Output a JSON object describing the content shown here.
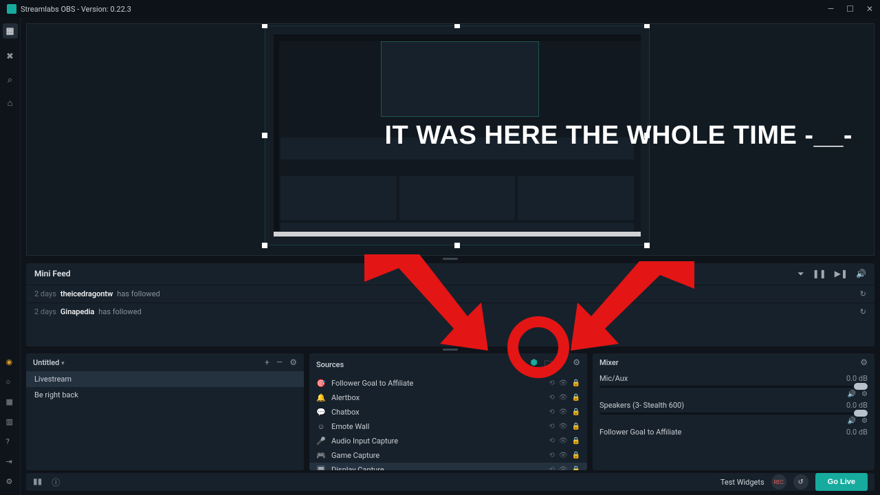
{
  "titlebar": {
    "title": "Streamlabs OBS - Version: 0.22.3"
  },
  "overlay": {
    "text": "IT WAS HERE THE WHOLE TIME -__-"
  },
  "minifeed": {
    "title": "Mini Feed",
    "items": [
      {
        "time": "2 days",
        "name": "theicedragontw",
        "action": "has followed"
      },
      {
        "time": "2 days",
        "name": "Ginapedia",
        "action": "has followed"
      }
    ]
  },
  "scenes": {
    "title": "Untitled",
    "items": [
      {
        "label": "Livestream",
        "selected": true
      },
      {
        "label": "Be right back",
        "selected": false
      }
    ]
  },
  "sources": {
    "title": "Sources",
    "items": [
      {
        "icon": "goal-icon",
        "glyph": "🎯",
        "label": "Follower Goal to Affiliate",
        "selected": false
      },
      {
        "icon": "bell-icon",
        "glyph": "🔔",
        "label": "Alertbox",
        "selected": false
      },
      {
        "icon": "chat-icon",
        "glyph": "💬",
        "label": "Chatbox",
        "selected": false
      },
      {
        "icon": "wall-icon",
        "glyph": "☺",
        "label": "Emote Wall",
        "selected": false
      },
      {
        "icon": "mic-icon",
        "glyph": "🎤",
        "label": "Audio Input Capture",
        "selected": false
      },
      {
        "icon": "gamepad-icon",
        "glyph": "🎮",
        "label": "Game Capture",
        "selected": false
      },
      {
        "icon": "monitor-icon",
        "glyph": "🖥",
        "label": "Display Capture",
        "selected": true
      }
    ]
  },
  "mixer": {
    "title": "Mixer",
    "items": [
      {
        "label": "Mic/Aux",
        "db": "0.0 dB"
      },
      {
        "label": "Speakers (3- Stealth 600)",
        "db": "0.0 dB"
      },
      {
        "label": "Follower Goal to Affiliate",
        "db": "0.0 dB"
      }
    ]
  },
  "footer": {
    "test_widgets": "Test Widgets",
    "rec": "REC",
    "go_live": "Go Live"
  }
}
